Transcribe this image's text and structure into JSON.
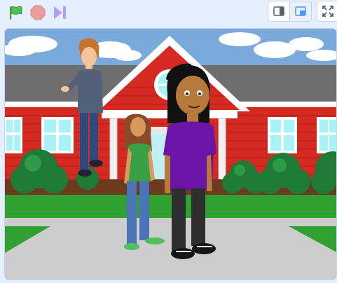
{
  "toolbar": {
    "green_flag": {
      "icon": "green-flag-icon",
      "color": "#4cbf56"
    },
    "stop": {
      "icon": "stop-icon",
      "color": "#ec9c9c"
    },
    "turbo": {
      "icon": "turbo-icon",
      "color": "#b5a0f5"
    },
    "small_stage": {
      "icon": "small-stage-icon"
    },
    "normal_stage": {
      "icon": "normal-stage-icon",
      "selected": true
    },
    "fullscreen": {
      "icon": "fullscreen-icon"
    }
  },
  "stage": {
    "backdrop": "school",
    "sprites": [
      "boy-sprite",
      "girl-green-sprite",
      "girl-purple-sprite"
    ]
  }
}
